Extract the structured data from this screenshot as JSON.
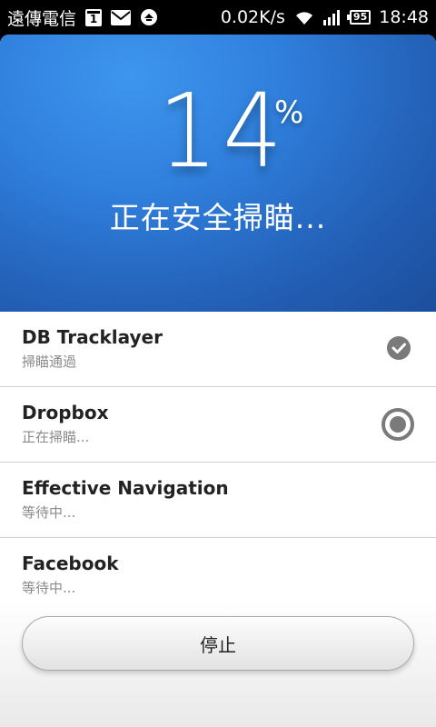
{
  "status_bar": {
    "carrier": "遠傳電信",
    "calendar_day": "1",
    "speed": "0.02K/s",
    "battery": "95",
    "time": "18:48"
  },
  "scan": {
    "percent": "14",
    "percent_sign": "%",
    "status": "正在安全掃瞄..."
  },
  "apps": [
    {
      "name": "DB Tracklayer",
      "status": "掃瞄通過",
      "state_icon": "check-icon"
    },
    {
      "name": "Dropbox",
      "status": "正在掃瞄...",
      "state_icon": "radio-scanning-icon"
    },
    {
      "name": "Effective Navigation",
      "status": "等待中..."
    },
    {
      "name": "Facebook",
      "status": "等待中..."
    }
  ],
  "footer": {
    "stop_label": "停止"
  },
  "colors": {
    "hero_blue": "#2f7fdc",
    "icon_gray": "#7a7a7a"
  }
}
